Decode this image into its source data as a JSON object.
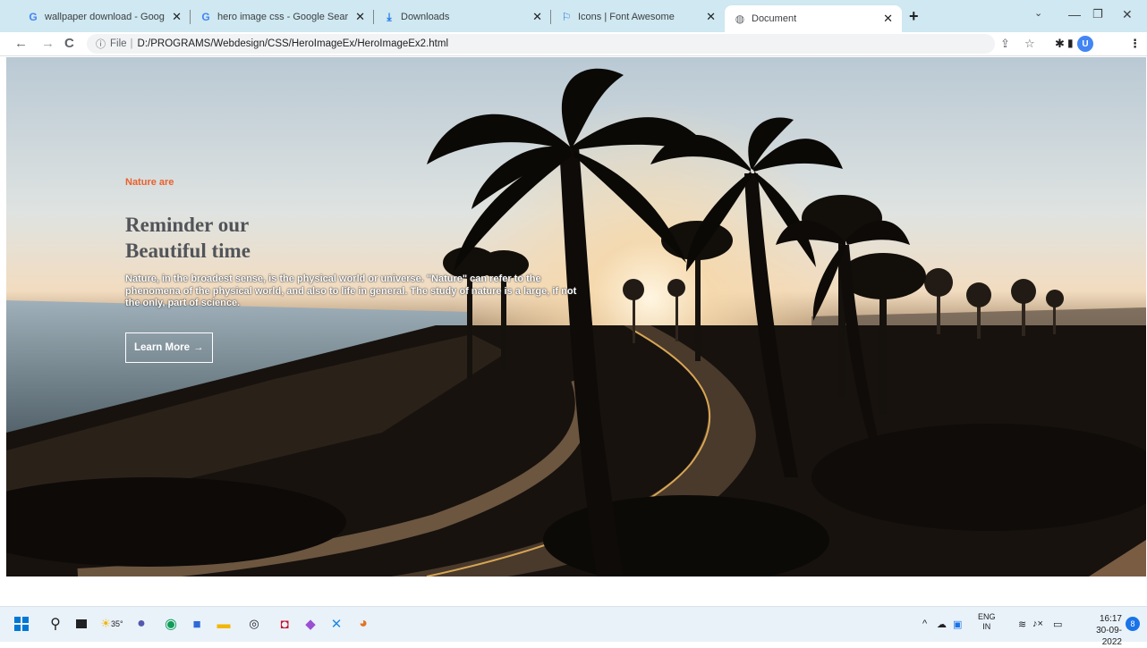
{
  "browser": {
    "tabs": [
      {
        "title": "wallpaper download - Google Se",
        "icon": "google-icon"
      },
      {
        "title": "hero image css - Google Search",
        "icon": "google-icon"
      },
      {
        "title": "Downloads",
        "icon": "download-icon"
      },
      {
        "title": "Icons | Font Awesome",
        "icon": "flag-icon"
      },
      {
        "title": "Document",
        "icon": "globe-icon",
        "active": true
      }
    ],
    "address": {
      "protocol": "File",
      "url": "D:/PROGRAMS/Webdesign/CSS/HeroImageEx/HeroImageEx2.html"
    },
    "profile_initial": "U"
  },
  "hero": {
    "kicker": "Nature are",
    "title_line1": "Reminder our",
    "title_line2": "Beautiful time",
    "paragraph": "Nature, in the broadest sense, is the physical world or universe. \"Nature\" can refer to the phenomena of the physical world, and also to life in general. The study of nature is a large, if not the only, part of science.",
    "button_label": "Learn More",
    "accent_color": "#e8612c"
  },
  "taskbar": {
    "weather": "35°",
    "language_line1": "ENG",
    "language_line2": "IN",
    "time": "16:17",
    "date": "30-09-2022",
    "notifications": "8"
  }
}
